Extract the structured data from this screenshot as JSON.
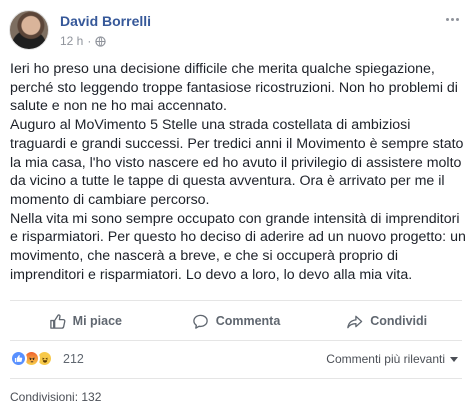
{
  "post": {
    "author": "David Borrelli",
    "time": "12 h",
    "separator": "·",
    "text_lines": [
      "Ieri ho preso una decisione difficile che merita qualche spiegazione,",
      "perché sto leggendo troppe fantasiose ricostruzioni. Non ho problemi di",
      "salute e non ne ho mai accennato.",
      "Auguro al MoVimento 5 Stelle una strada costellata di ambiziosi",
      "traguardi e grandi successi. Per tredici anni il Movimento è sempre stato",
      "la mia casa, l'ho visto nascere ed ho avuto il privilegio di assistere molto",
      "da vicino a tutte le tappe di questa avventura. Ora è arrivato per me il",
      "momento di cambiare percorso.",
      "Nella vita mi sono sempre occupato con grande intensità di imprenditori",
      "e risparmiatori. Per questo ho deciso di aderire ad un nuovo progetto: un",
      "movimento, che nascerà a breve, e che si occuperà proprio di",
      "imprenditori e risparmiatori. Lo devo a loro, lo devo alla mia vita."
    ]
  },
  "actions": {
    "like": "Mi piace",
    "comment": "Commenta",
    "share": "Condividi"
  },
  "reactions": {
    "types": [
      "like-icon",
      "angry-icon",
      "haha-icon"
    ],
    "count": "212"
  },
  "comments_sort": "Commenti più rilevanti",
  "shares": "Condivisioni: 132",
  "colors": {
    "author": "#365899",
    "secondary_text": "#90949c",
    "action_text": "#606770"
  }
}
